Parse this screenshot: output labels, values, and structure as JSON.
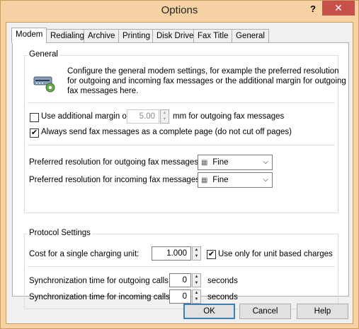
{
  "window": {
    "title": "Options",
    "help": "?",
    "close": "✕"
  },
  "tabs": [
    "Modem",
    "Redialing",
    "Archive",
    "Printing",
    "Disk Drive",
    "Fax Title",
    "General"
  ],
  "general": {
    "label": "General",
    "description_lines": [
      "Configure the general modem settings, for example the preferred resolution",
      "for outgoing and incoming fax messages or the additional margin for outgoing",
      "fax messages here."
    ],
    "margin_label": "Use additional margin of",
    "margin_value": "5.00",
    "margin_unit": "mm for outgoing fax messages",
    "margin_checked": false,
    "complete_page_label": "Always send fax messages as a complete page (do not cut off pages)",
    "complete_page_checked": true,
    "res_out_label": "Preferred resolution for outgoing fax messages:",
    "res_out_value": "Fine",
    "res_in_label": "Preferred resolution for incoming fax messages:",
    "res_in_value": "Fine"
  },
  "protocol": {
    "label": "Protocol Settings",
    "cost_label": "Cost for a single charging unit:",
    "cost_value": "1.000",
    "unit_based_label": "Use only for unit based charges",
    "unit_based_checked": true,
    "sync_out_label": "Synchronization time for outgoing calls:",
    "sync_out_value": "0",
    "sync_in_label": "Synchronization time for incoming calls:",
    "sync_in_value": "0",
    "seconds": "seconds"
  },
  "buttons": {
    "ok": "OK",
    "cancel": "Cancel",
    "help": "Help"
  }
}
